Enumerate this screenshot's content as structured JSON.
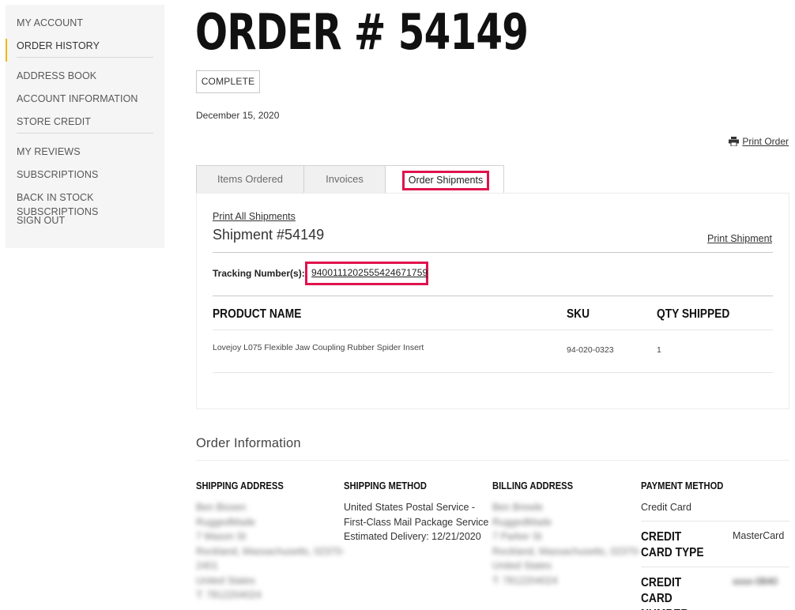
{
  "sidebar": {
    "items": [
      {
        "label": "MY ACCOUNT"
      },
      {
        "label": "ORDER HISTORY"
      },
      {
        "label": "ADDRESS BOOK"
      },
      {
        "label": "ACCOUNT INFORMATION"
      },
      {
        "label": "STORE CREDIT"
      },
      {
        "label": "MY REVIEWS"
      },
      {
        "label": "SUBSCRIPTIONS"
      },
      {
        "label": "BACK IN STOCK SUBSCRIPTIONS"
      },
      {
        "label": "SIGN OUT"
      }
    ]
  },
  "order": {
    "title": "ORDER # 54149",
    "status": "COMPLETE",
    "date": "December 15, 2020",
    "print_order": "Print Order"
  },
  "tabs": [
    "Items Ordered",
    "Invoices",
    "Order Shipments"
  ],
  "shipment": {
    "print_all": "Print All Shipments",
    "title": "Shipment #54149",
    "print_shipment": "Print Shipment",
    "tracking_label": "Tracking Number(s):",
    "tracking_number": "9400111202555424671759",
    "columns": [
      "PRODUCT NAME",
      "SKU",
      "QTY SHIPPED"
    ],
    "rows": [
      {
        "product": "Lovejoy L075 Flexible Jaw Coupling Rubber Spider Insert",
        "sku": "94-020-0323",
        "qty": "1"
      }
    ]
  },
  "order_info": {
    "title": "Order Information",
    "shipping_address": {
      "heading": "SHIPPING ADDRESS",
      "lines": [
        "Ben Bissen",
        "RuggedMade",
        "7 Mason St",
        "Rockland, Massachusetts, 02370-",
        "2401",
        "United States",
        "T: 7812204024"
      ]
    },
    "shipping_method": {
      "heading": "SHIPPING METHOD",
      "lines": [
        "United States Postal Service -",
        "First-Class Mail Package Service",
        "Estimated Delivery: 12/21/2020"
      ]
    },
    "billing_address": {
      "heading": "BILLING ADDRESS",
      "lines": [
        "Ben Brewle",
        "RuggedMade",
        "7 Parker St",
        "Rockland, Massachusetts, 02370-",
        "United States",
        "T: 7812204024"
      ]
    },
    "payment_method": {
      "heading": "PAYMENT METHOD",
      "method": "Credit Card",
      "cc_type_label": "CREDIT CARD TYPE",
      "cc_type": "MasterCard",
      "cc_number_label": "CREDIT CARD NUMBER",
      "cc_number": "xxxx-0840"
    }
  }
}
